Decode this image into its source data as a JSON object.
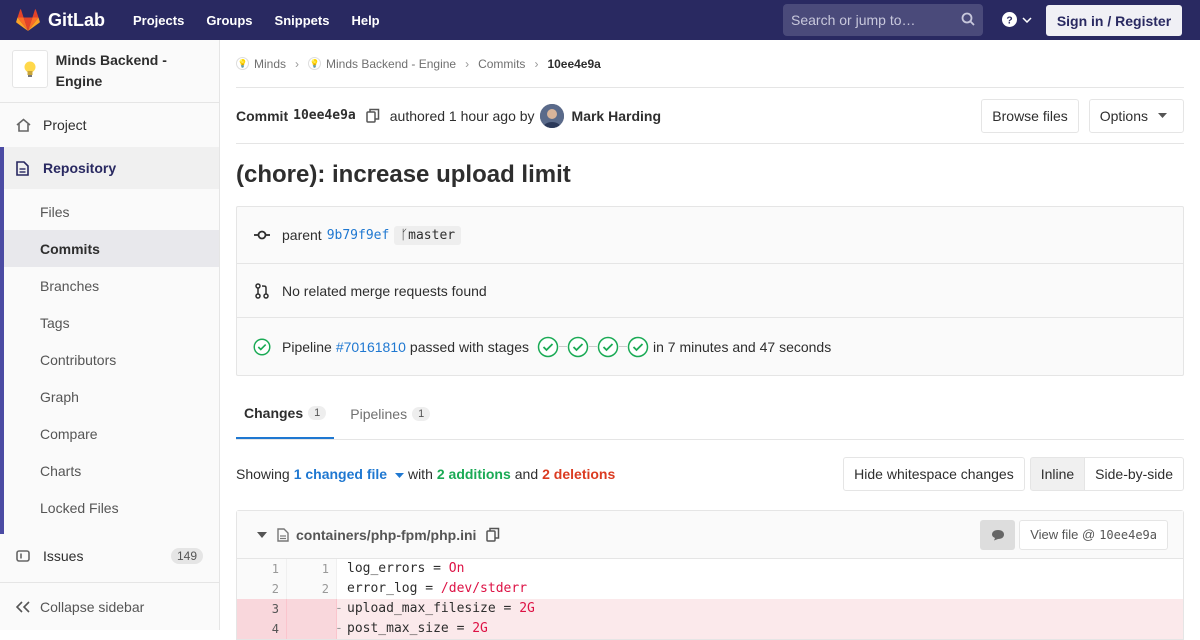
{
  "navbar": {
    "brand": "GitLab",
    "links": [
      "Projects",
      "Groups",
      "Snippets",
      "Help"
    ],
    "search_placeholder": "Search or jump to…",
    "signin_label": "Sign in / Register"
  },
  "sidebar": {
    "project_name": "Minds Backend - Engine",
    "project_label": "Project",
    "repository_label": "Repository",
    "repo_items": [
      "Files",
      "Commits",
      "Branches",
      "Tags",
      "Contributors",
      "Graph",
      "Compare",
      "Charts",
      "Locked Files"
    ],
    "active_item": "Commits",
    "issues_label": "Issues",
    "issues_count": "149",
    "collapse_label": "Collapse sidebar"
  },
  "breadcrumb": [
    "Minds",
    "Minds Backend - Engine",
    "Commits",
    "10ee4e9a"
  ],
  "commit": {
    "label": "Commit",
    "sha": "10ee4e9a",
    "authored_text": "authored 1 hour ago by",
    "author": "Mark Harding",
    "browse_files": "Browse files",
    "options": "Options",
    "title": "(chore): increase upload limit",
    "parent_label": "parent",
    "parent_sha": "9b79f9ef",
    "branch": "master",
    "merge_requests": "No related merge requests found",
    "pipeline_label": "Pipeline",
    "pipeline_id": "#70161810",
    "pipeline_status": "passed with stages",
    "pipeline_duration": "in 7 minutes and 47 seconds"
  },
  "tabs": [
    {
      "label": "Changes",
      "count": "1"
    },
    {
      "label": "Pipelines",
      "count": "1"
    }
  ],
  "changes": {
    "showing": "Showing",
    "changed_files": "1 changed file",
    "with": "with",
    "additions": "2 additions",
    "and": "and",
    "deletions": "2 deletions",
    "hide_whitespace": "Hide whitespace changes",
    "inline": "Inline",
    "side_by_side": "Side-by-side"
  },
  "file": {
    "path": "containers/php-fpm/php.ini",
    "view_file_label": "View file @",
    "view_file_sha": "10ee4e9a",
    "lines": [
      {
        "old": "1",
        "new": "1",
        "type": "context",
        "key": "log_errors = ",
        "val": "On"
      },
      {
        "old": "2",
        "new": "2",
        "type": "context",
        "key": "error_log = ",
        "val": "/dev/stderr"
      },
      {
        "old": "3",
        "new": "",
        "type": "del",
        "key": "upload_max_filesize = ",
        "val": "2G"
      },
      {
        "old": "4",
        "new": "",
        "type": "del",
        "key": "post_max_size = ",
        "val": "2G"
      }
    ]
  },
  "colors": {
    "navbar": "#292961",
    "link": "#1f78d1",
    "success": "#1aaa55",
    "danger": "#db3b21"
  }
}
